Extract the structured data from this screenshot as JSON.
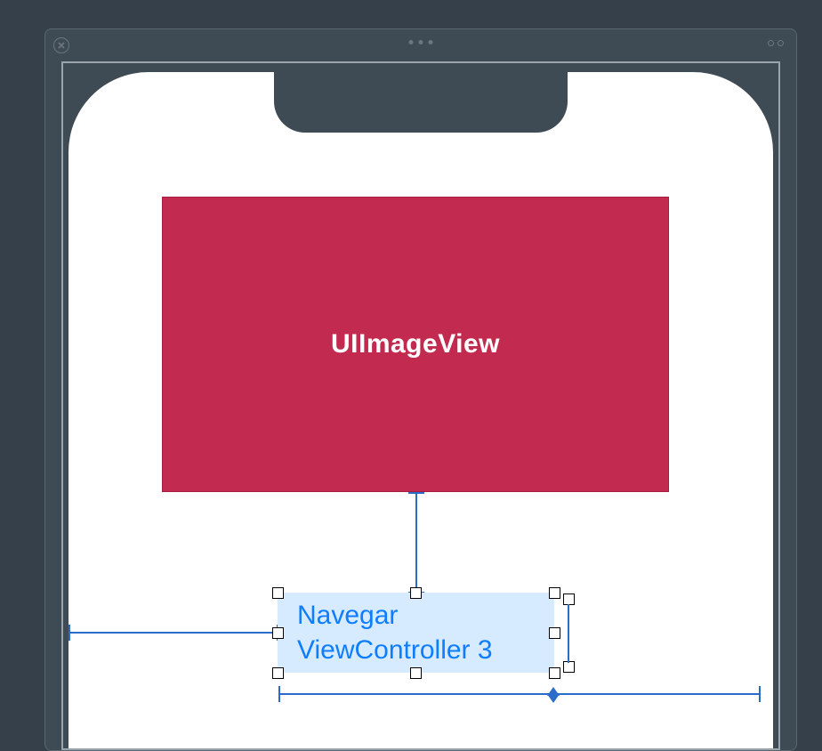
{
  "canvas": {
    "image_view_label": "UIImageView",
    "button_label": "Navegar\nViewController 3"
  },
  "colors": {
    "image_view_bg": "#c22b4f",
    "button_bg": "#d6ebff",
    "button_text": "#0f7dff",
    "constraint": "#2a6cc9"
  }
}
